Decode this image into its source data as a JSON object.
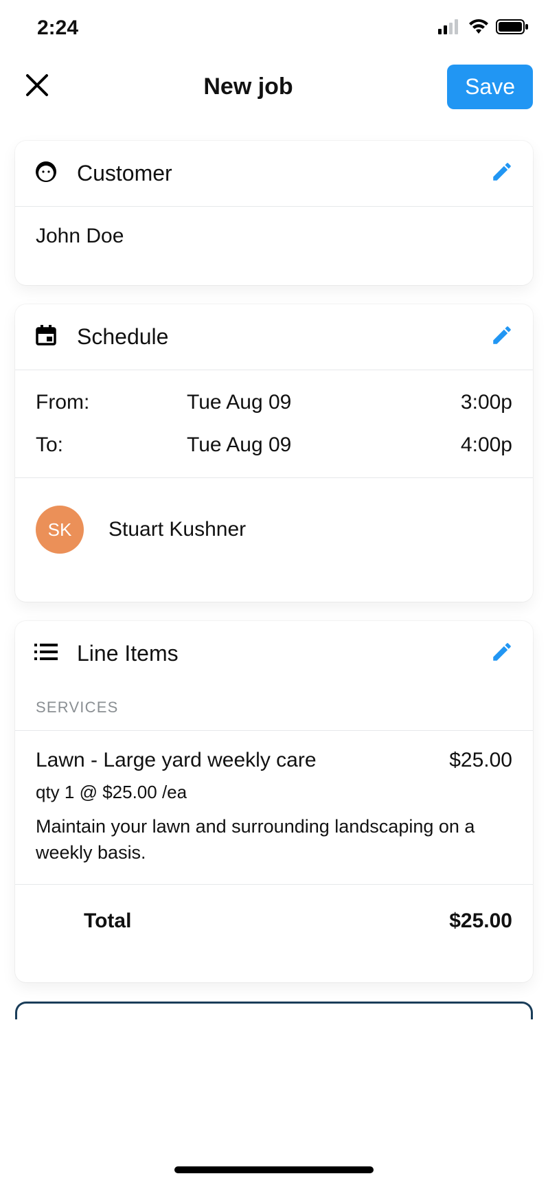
{
  "status": {
    "time": "2:24"
  },
  "header": {
    "title": "New job",
    "save_label": "Save"
  },
  "customer": {
    "section_title": "Customer",
    "name": "John Doe"
  },
  "schedule": {
    "section_title": "Schedule",
    "from_label": "From:",
    "to_label": "To:",
    "from_date": "Tue Aug 09",
    "from_time": "3:00p",
    "to_date": "Tue Aug 09",
    "to_time": "4:00p",
    "assignee": {
      "initials": "SK",
      "name": "Stuart Kushner"
    }
  },
  "line_items": {
    "section_title": "Line Items",
    "group_label": "SERVICES",
    "items": [
      {
        "name": "Lawn - Large yard weekly care",
        "price": "$25.00",
        "qty_line": "qty 1 @ $25.00 /ea",
        "description": "Maintain your lawn and surrounding landscaping on a weekly basis."
      }
    ],
    "total_label": "Total",
    "total_value": "$25.00"
  }
}
